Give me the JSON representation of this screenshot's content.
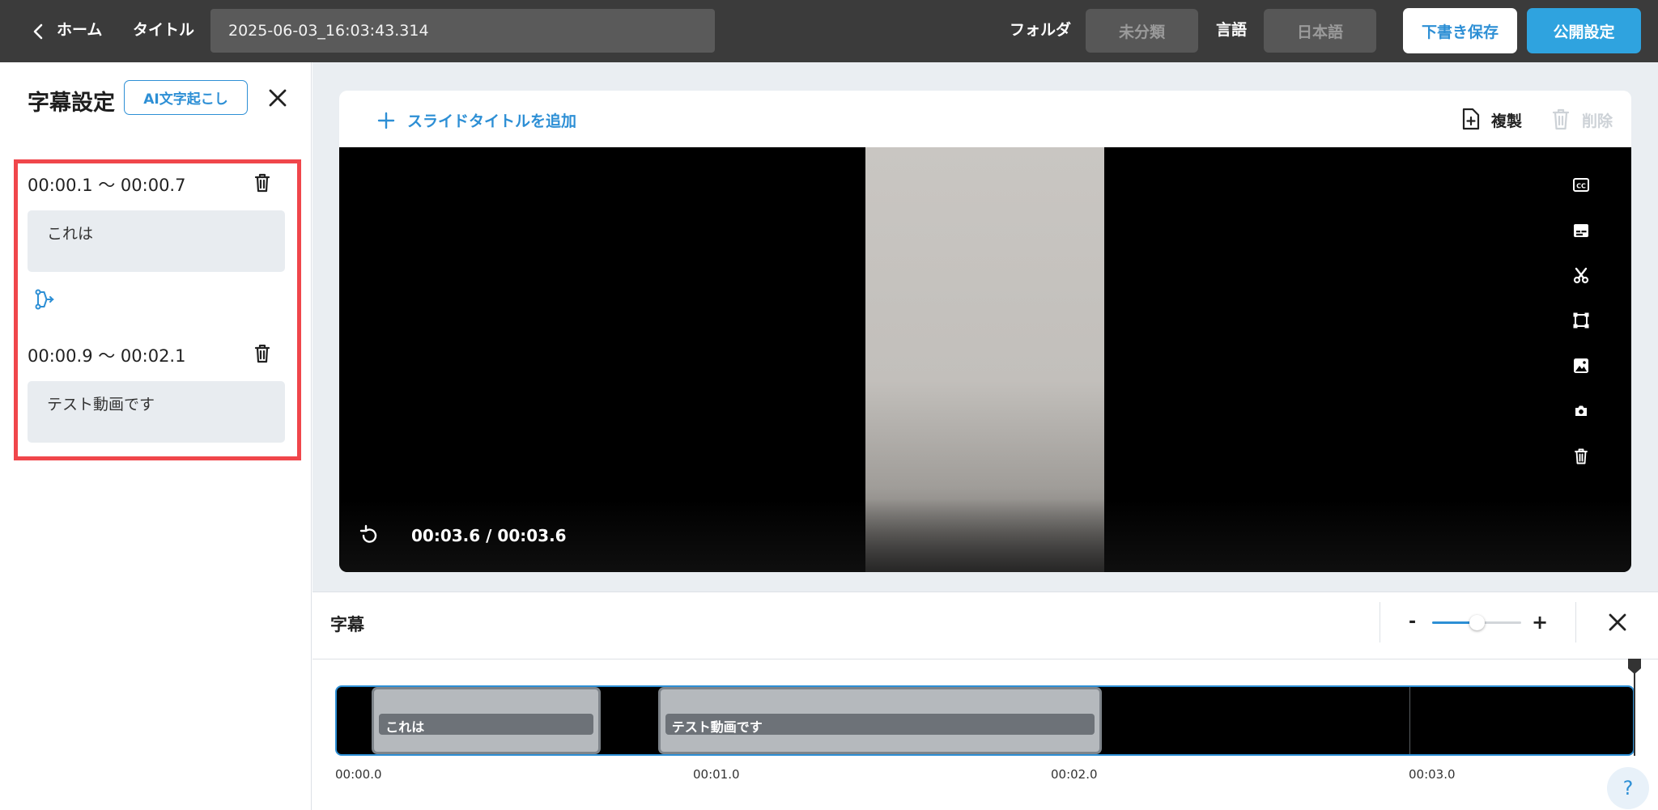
{
  "topbar": {
    "home_label": "ホーム",
    "title_label": "タイトル",
    "title_value": "2025-06-03_16:03:43.314",
    "folder_label": "フォルダ",
    "folder_value": "未分類",
    "language_label": "言語",
    "language_value": "日本語",
    "save_draft_label": "下書き保存",
    "publish_settings_label": "公開設定"
  },
  "subtitle_panel": {
    "title": "字幕設定",
    "ai_button_label": "AI文字起こし",
    "items": [
      {
        "time": "00:00.1 〜 00:00.7",
        "text": "これは"
      },
      {
        "time": "00:00.9 〜 00:02.1",
        "text": "テスト動画です"
      }
    ]
  },
  "slide": {
    "add_title_label": "スライドタイトルを追加",
    "duplicate_label": "複製",
    "delete_label": "削除",
    "time_readout": "00:03.6 / 00:03.6",
    "side_tools": [
      "cc-icon",
      "subtitles-icon",
      "scissors-icon",
      "crop-icon",
      "image-icon",
      "camera-icon",
      "trash-icon"
    ]
  },
  "timeline": {
    "title": "字幕",
    "zoom_minus": "-",
    "zoom_plus": "+",
    "zoom_level": 0.5,
    "ticks": [
      "00:00.0",
      "00:01.0",
      "00:02.0",
      "00:03.0"
    ],
    "clips": [
      {
        "label": "これは",
        "start": 0.1,
        "end": 0.7
      },
      {
        "label": "テスト動画です",
        "start": 0.9,
        "end": 2.1
      }
    ],
    "playhead": 3.6,
    "duration": 3.6
  },
  "colors": {
    "accent": "#2d8fd5",
    "publish": "#2fa3df",
    "topbar": "#3b3b3b",
    "highlight": "#f0464b"
  }
}
